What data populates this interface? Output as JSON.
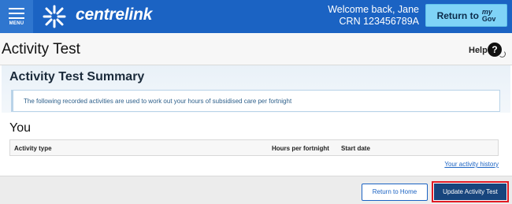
{
  "header": {
    "menu_label": "MENU",
    "brand": "centrelink",
    "welcome": "Welcome back, Jane",
    "crn": "CRN 123456789A",
    "return_label": "Return to",
    "mygov_my": "my",
    "mygov_gov": "Gov",
    "color": "#1b63c3"
  },
  "page": {
    "title": "Activity Test",
    "help_label": "Help",
    "help_icon": "?"
  },
  "summary": {
    "title": "Activity Test Summary",
    "info": "The following recorded activities are used to work out your hours of subsidised care per fortnight"
  },
  "you": {
    "title": "You",
    "columns": [
      "Activity type",
      "Hours per fortnight",
      "Start date"
    ],
    "history_link": "Your activity history"
  },
  "footer": {
    "return_home": "Return to Home",
    "update": "Update Activity Test",
    "highlight_color": "#e01b24"
  }
}
